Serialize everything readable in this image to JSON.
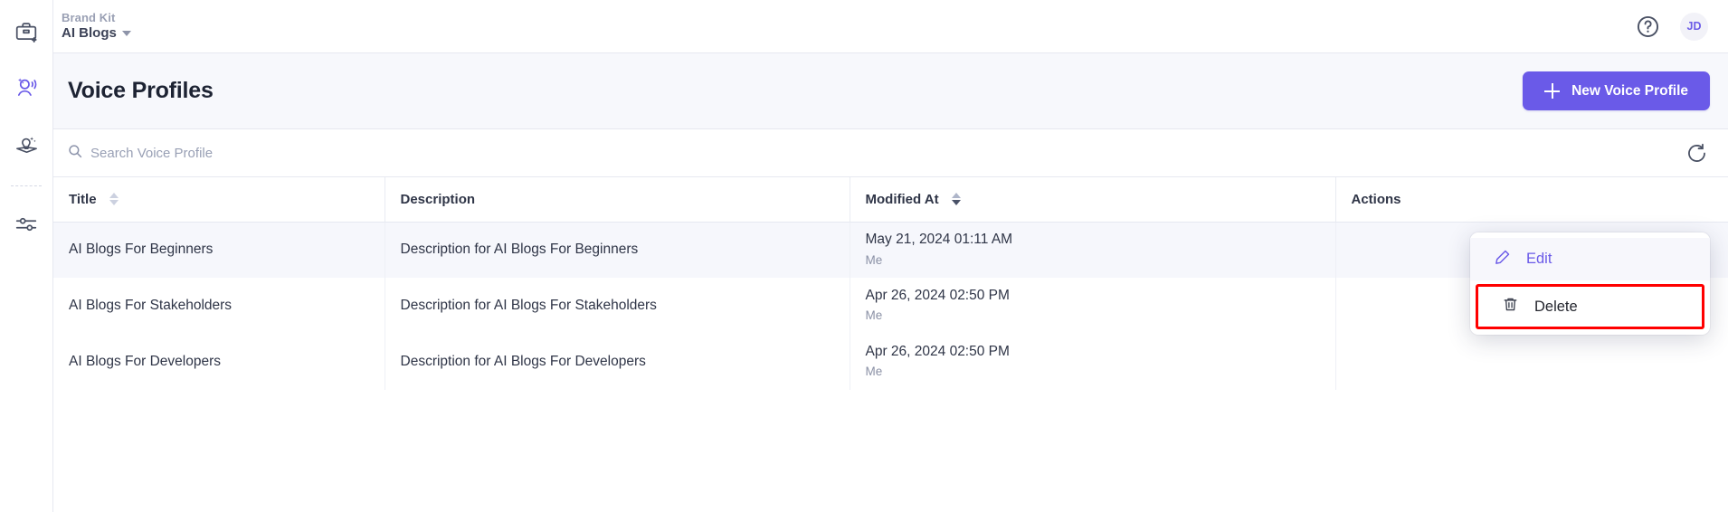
{
  "sidebar": {
    "items": [
      {
        "name": "brand-kit",
        "icon": "briefcase-sparkle-icon",
        "active": false
      },
      {
        "name": "voice-profiles",
        "icon": "voice-person-icon",
        "active": true
      },
      {
        "name": "insights",
        "icon": "lightbulb-book-icon",
        "active": false
      },
      {
        "name": "settings",
        "icon": "sliders-icon",
        "active": false
      }
    ]
  },
  "topbar": {
    "breadcrumb_top": "Brand Kit",
    "breadcrumb_bottom": "AI Blogs",
    "caret_icon": "chevron-down-icon",
    "help_icon": "help-circle-icon",
    "avatar_initials": "JD"
  },
  "pagehead": {
    "title": "Voice Profiles",
    "new_button_label": "New Voice Profile",
    "new_button_icon": "plus-icon",
    "accent_color": "#6a5ae8"
  },
  "search": {
    "icon": "search-icon",
    "placeholder": "Search Voice Profile",
    "value": "",
    "refresh_icon": "refresh-icon"
  },
  "table": {
    "columns": [
      {
        "label": "Title",
        "sortable": true,
        "sort_state": "none"
      },
      {
        "label": "Description",
        "sortable": false,
        "sort_state": "none"
      },
      {
        "label": "Modified At",
        "sortable": true,
        "sort_state": "desc"
      },
      {
        "label": "Actions",
        "sortable": false,
        "sort_state": "none"
      }
    ],
    "rows": [
      {
        "title": "AI Blogs For Beginners",
        "description": "Description for AI Blogs For Beginners",
        "modified_at": "May 21, 2024 01:11 AM",
        "modified_by": "Me",
        "actions_icon": "kebab-menu-icon"
      },
      {
        "title": "AI Blogs For Stakeholders",
        "description": "Description for AI Blogs For Stakeholders",
        "modified_at": "Apr 26, 2024 02:50 PM",
        "modified_by": "Me",
        "actions_icon": "kebab-menu-icon"
      },
      {
        "title": "AI Blogs For Developers",
        "description": "Description for AI Blogs For Developers",
        "modified_at": "Apr 26, 2024 02:50 PM",
        "modified_by": "Me",
        "actions_icon": "kebab-menu-icon"
      }
    ]
  },
  "dropdown": {
    "edit_label": "Edit",
    "edit_icon": "pencil-icon",
    "delete_label": "Delete",
    "delete_icon": "trash-icon",
    "highlight_color": "#ff0000"
  }
}
